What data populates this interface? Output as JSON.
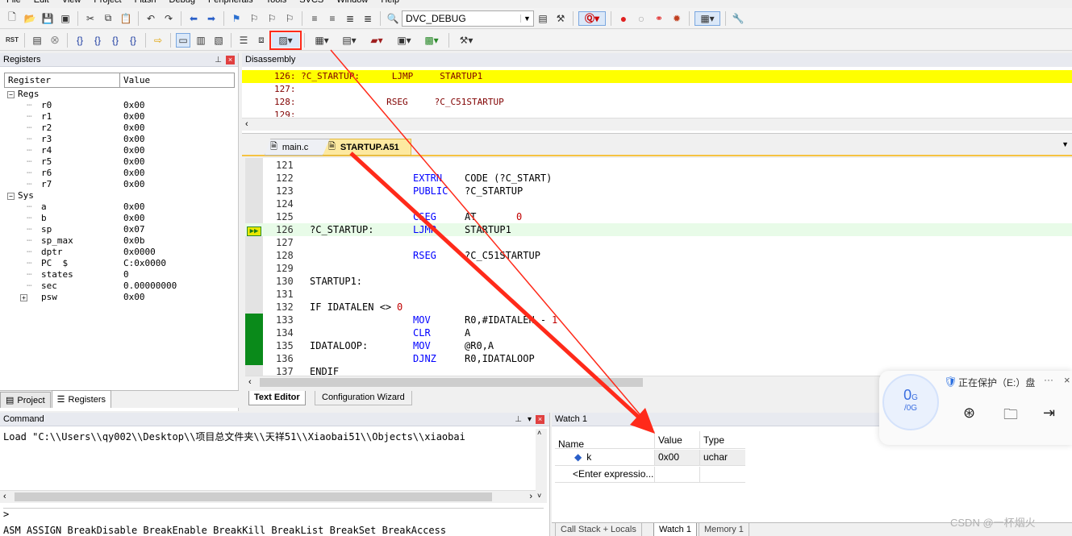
{
  "menu": [
    "File",
    "Edit",
    "View",
    "Project",
    "Flash",
    "Debug",
    "Peripherals",
    "Tools",
    "SVCS",
    "Window",
    "Help"
  ],
  "toolbar": {
    "target": "DVC_DEBUG",
    "rst_label": "RST"
  },
  "registers": {
    "title": "Registers",
    "col_register": "Register",
    "col_value": "Value",
    "groups": [
      {
        "name": "Regs",
        "rows": [
          [
            "r0",
            "0x00"
          ],
          [
            "r1",
            "0x00"
          ],
          [
            "r2",
            "0x00"
          ],
          [
            "r3",
            "0x00"
          ],
          [
            "r4",
            "0x00"
          ],
          [
            "r5",
            "0x00"
          ],
          [
            "r6",
            "0x00"
          ],
          [
            "r7",
            "0x00"
          ]
        ]
      },
      {
        "name": "Sys",
        "rows": [
          [
            "a",
            "0x00"
          ],
          [
            "b",
            "0x00"
          ],
          [
            "sp",
            "0x07"
          ],
          [
            "sp_max",
            "0x0b"
          ],
          [
            "dptr",
            "0x0000"
          ],
          [
            "PC  $",
            "C:0x0000"
          ],
          [
            "states",
            "0"
          ],
          [
            "sec",
            "0.00000000"
          ],
          [
            "psw",
            "0x00"
          ]
        ]
      }
    ],
    "tab_project": "Project",
    "tab_registers": "Registers"
  },
  "disassembly": {
    "title": "Disassembly",
    "lines": [
      {
        "text": "126: ?C_STARTUP:      LJMP     STARTUP1",
        "hl": true
      },
      {
        "text": "127:",
        "hl": false
      },
      {
        "text": "128:                 RSEG     ?C_C51STARTUP",
        "hl": false
      },
      {
        "text": "129:",
        "hl": false
      }
    ]
  },
  "editor": {
    "tabs": [
      {
        "label": "main.c",
        "active": false
      },
      {
        "label": "STARTUP.A51",
        "active": true
      }
    ],
    "lines": [
      {
        "n": "121",
        "label": "",
        "op": "",
        "arg": "",
        "num": "",
        "mark": ""
      },
      {
        "n": "122",
        "label": "",
        "op": "EXTRN",
        "arg": "CODE (?C_START)",
        "num": "",
        "mark": ""
      },
      {
        "n": "123",
        "label": "",
        "op": "PUBLIC",
        "arg": "?C_STARTUP",
        "num": "",
        "mark": ""
      },
      {
        "n": "124",
        "label": "",
        "op": "",
        "arg": "",
        "num": "",
        "mark": ""
      },
      {
        "n": "125",
        "label": "",
        "op": "CSEG",
        "arg": "AT",
        "num": "0",
        "mark": ""
      },
      {
        "n": "126",
        "label": "?C_STARTUP:",
        "op": "LJMP",
        "arg": "STARTUP1",
        "num": "",
        "mark": "cur"
      },
      {
        "n": "127",
        "label": "",
        "op": "",
        "arg": "",
        "num": "",
        "mark": ""
      },
      {
        "n": "128",
        "label": "",
        "op": "RSEG",
        "arg": "?C_C51STARTUP",
        "num": "",
        "mark": ""
      },
      {
        "n": "129",
        "label": "",
        "op": "",
        "arg": "",
        "num": "",
        "mark": ""
      },
      {
        "n": "130",
        "label": "STARTUP1:",
        "op": "",
        "arg": "",
        "num": "",
        "mark": ""
      },
      {
        "n": "131",
        "label": "",
        "op": "",
        "arg": "",
        "num": "",
        "mark": ""
      },
      {
        "n": "132",
        "label": "IF IDATALEN <> ",
        "op": "",
        "arg": "",
        "num": "0",
        "mark": ""
      },
      {
        "n": "133",
        "label": "",
        "op": "MOV",
        "arg": "R0,#IDATALEN - ",
        "num": "1",
        "mark": "g"
      },
      {
        "n": "134",
        "label": "",
        "op": "CLR",
        "arg": "A",
        "num": "",
        "mark": "g"
      },
      {
        "n": "135",
        "label": "IDATALOOP:",
        "op": "MOV",
        "arg": "@R0,A",
        "num": "",
        "mark": "g"
      },
      {
        "n": "136",
        "label": "",
        "op": "DJNZ",
        "arg": "R0,IDATALOOP",
        "num": "",
        "mark": "g"
      },
      {
        "n": "137",
        "label": "ENDIF",
        "op": "",
        "arg": "",
        "num": "",
        "mark": ""
      }
    ],
    "bottom_tab_text": "Text Editor",
    "bottom_tab_wizard": "Configuration Wizard"
  },
  "command": {
    "title": "Command",
    "output": "Load \"C:\\\\Users\\\\qy002\\\\Desktop\\\\项目总文件夹\\\\天祥51\\\\Xiaobai51\\\\Objects\\\\xiaobai",
    "prompt": ">",
    "hints": "ASM ASSIGN BreakDisable BreakEnable BreakKill BreakList BreakSet BreakAccess"
  },
  "watch": {
    "title": "Watch 1",
    "col_name": "Name",
    "col_value": "Value",
    "col_type": "Type",
    "rows": [
      {
        "name": "k",
        "value": "0x00",
        "type": "uchar"
      }
    ],
    "enter_expr": "<Enter expressio...",
    "tabs": [
      "Call Stack + Locals",
      "Watch 1",
      "Memory 1"
    ]
  },
  "overlay": {
    "gauge_value": "0",
    "gauge_unit": "G",
    "gauge_sub": "/0G",
    "protect_text": "正在保护（E:）盘",
    "more": "···"
  },
  "watermark": "CSDN @一杯烟火",
  "colors": {
    "highlight": "#ffff00",
    "current_line": "#e8fbe8",
    "arrow": "#ff2a1a",
    "keyword": "#0000ff",
    "number": "#c00000"
  }
}
